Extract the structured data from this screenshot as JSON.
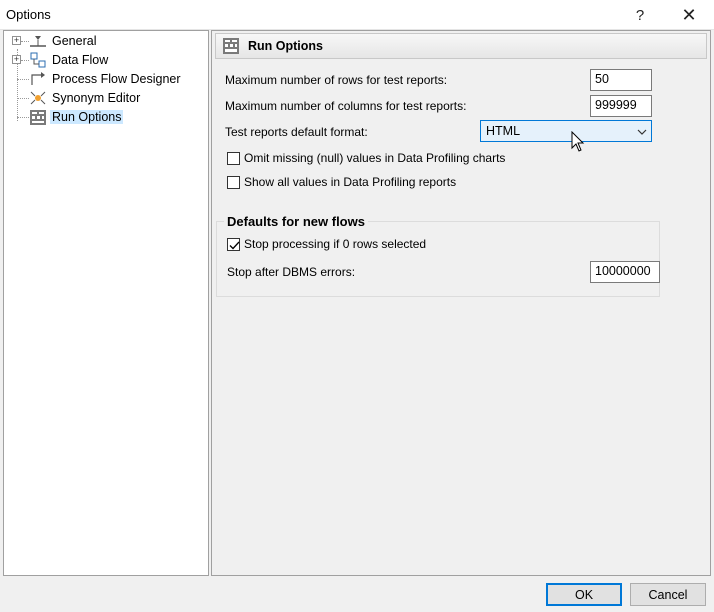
{
  "window": {
    "title": "Options",
    "help": "?",
    "close": "✕"
  },
  "tree": {
    "items": [
      {
        "label": "General",
        "icon": "general-icon",
        "expandable": true
      },
      {
        "label": "Data Flow",
        "icon": "data-flow-icon",
        "expandable": true
      },
      {
        "label": "Process Flow Designer",
        "icon": "process-flow-icon",
        "expandable": false
      },
      {
        "label": "Synonym Editor",
        "icon": "synonym-editor-icon",
        "expandable": false
      },
      {
        "label": "Run Options",
        "icon": "run-options-icon",
        "expandable": false,
        "selected": true
      }
    ]
  },
  "panel": {
    "title": "Run Options",
    "max_rows_label": "Maximum number of rows for test reports:",
    "max_rows_value": "50",
    "max_cols_label": "Maximum number of columns for test reports:",
    "max_cols_value": "999999",
    "format_label": "Test reports default format:",
    "format_value": "HTML",
    "omit_label": "Omit missing (null) values in Data Profiling charts",
    "omit_checked": false,
    "show_all_label": "Show all values in Data Profiling reports",
    "show_all_checked": false,
    "group_title": "Defaults for new flows",
    "stop_processing_label": "Stop processing if 0 rows selected",
    "stop_processing_checked": true,
    "stop_dbms_label": "Stop after DBMS errors:",
    "stop_dbms_value": "10000000"
  },
  "buttons": {
    "ok": "OK",
    "cancel": "Cancel"
  },
  "colors": {
    "accent": "#0078d7",
    "selection": "#cce8ff"
  }
}
